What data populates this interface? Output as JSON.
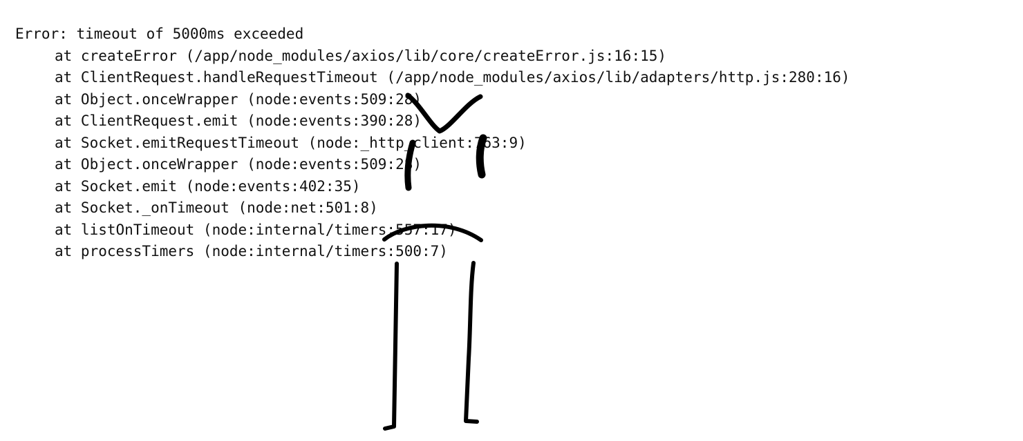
{
  "error": {
    "message": "Error: timeout of 5000ms exceeded",
    "stack": [
      "at createError (/app/node_modules/axios/lib/core/createError.js:16:15)",
      "at ClientRequest.handleRequestTimeout (/app/node_modules/axios/lib/adapters/http.js:280:16)",
      "at Object.onceWrapper (node:events:509:28)",
      "at ClientRequest.emit (node:events:390:28)",
      "at Socket.emitRequestTimeout (node:_http_client:763:9)",
      "at Object.onceWrapper (node:events:509:28)",
      "at Socket.emit (node:events:402:35)",
      "at Socket._onTimeout (node:net:501:8)",
      "at listOnTimeout (node:internal/timers:557:17)",
      "at processTimers (node:internal/timers:500:7)"
    ]
  },
  "colors": {
    "background": "#ffffff",
    "text": "#111111",
    "ink": "#000000"
  }
}
